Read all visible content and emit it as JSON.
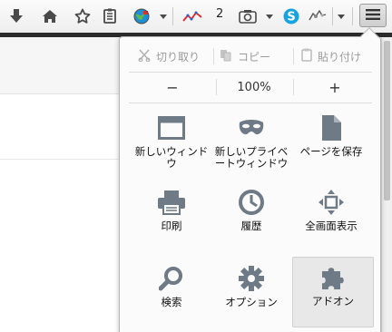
{
  "toolbar": {
    "icons": [
      "download-icon",
      "home-icon",
      "bookmark-star-icon",
      "bookmarks-list-icon",
      "globe-addon-icon",
      "graph-addon-icon",
      "camera-icon",
      "skype-icon",
      "puzzle-addon-icon",
      "menu-icon"
    ],
    "badge_count": "2"
  },
  "panel": {
    "edit": {
      "cut": "切り取り",
      "copy": "コピー",
      "paste": "貼り付け"
    },
    "zoom": {
      "minus": "−",
      "level": "100%",
      "plus": "+"
    },
    "items": [
      {
        "label": "新しいウィンドウ",
        "icon": "new-window-icon"
      },
      {
        "label": "新しいプライベートウィンドウ",
        "icon": "private-mask-icon"
      },
      {
        "label": "ページを保存",
        "icon": "save-page-icon"
      },
      {
        "label": "印刷",
        "icon": "printer-icon"
      },
      {
        "label": "履歴",
        "icon": "clock-icon"
      },
      {
        "label": "全画面表示",
        "icon": "fullscreen-icon"
      },
      {
        "label": "検索",
        "icon": "search-icon"
      },
      {
        "label": "オプション",
        "icon": "gear-icon"
      },
      {
        "label": "アドオン",
        "icon": "puzzle-icon"
      }
    ]
  },
  "colors": {
    "icon_gray": "#6e7a85",
    "panel_bg": "#fbfbfb",
    "selected_bg": "#e8e8e8"
  }
}
